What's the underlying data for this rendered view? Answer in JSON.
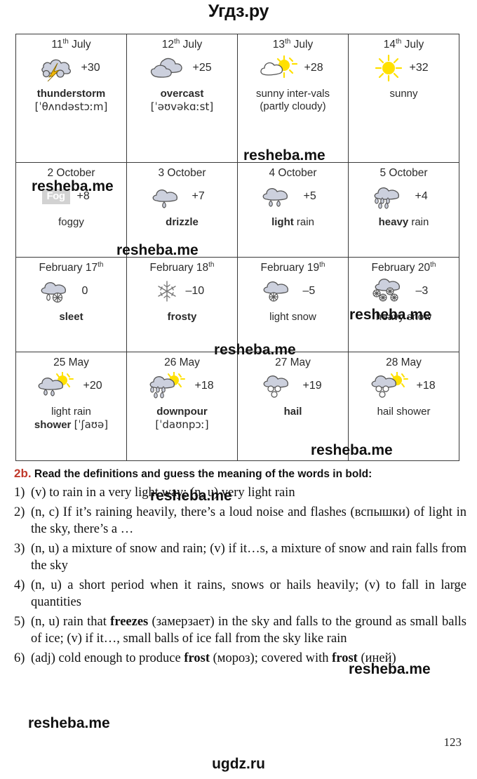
{
  "header": {
    "site_title": "Угдз.ру"
  },
  "footer": {
    "site_title": "ugdz.ru",
    "page_number": "123"
  },
  "weather_table": {
    "rows": [
      [
        {
          "date_num": "11",
          "date_sup": "th",
          "date_rest": " July",
          "date_prefix": "",
          "icon": "thunderstorm-icon",
          "temp": "+30",
          "label_bold": "thunderstorm",
          "label_plain": "",
          "ipa": "[ˈθʌndəstɔːm]"
        },
        {
          "date_num": "12",
          "date_sup": "th",
          "date_rest": " July",
          "date_prefix": "",
          "icon": "overcast-cloud-icon",
          "temp": "+25",
          "label_bold": "overcast",
          "label_plain": "",
          "ipa": "[ˈəʊvəkɑːst]"
        },
        {
          "date_num": "13",
          "date_sup": "th",
          "date_rest": " July",
          "date_prefix": "",
          "icon": "sun-behind-cloud-icon",
          "temp": "+28",
          "label_bold": "",
          "label_plain": "sunny inter-vals (partly cloudy)",
          "ipa": ""
        },
        {
          "date_num": "14",
          "date_sup": "th",
          "date_rest": " July",
          "date_prefix": "",
          "icon": "sun-icon",
          "temp": "+32",
          "label_bold": "",
          "label_plain": "sunny",
          "ipa": ""
        }
      ],
      [
        {
          "date_num": "2",
          "date_sup": "",
          "date_rest": " October",
          "date_prefix": "",
          "icon": "fog-badge-icon",
          "temp": "+8",
          "label_bold": "",
          "label_plain": "foggy",
          "ipa": ""
        },
        {
          "date_num": "3",
          "date_sup": "",
          "date_rest": " October",
          "date_prefix": "",
          "icon": "drizzle-icon",
          "temp": "+7",
          "label_bold": "drizzle",
          "label_plain": "",
          "ipa": ""
        },
        {
          "date_num": "4",
          "date_sup": "",
          "date_rest": " October",
          "date_prefix": "",
          "icon": "light-rain-icon",
          "temp": "+5",
          "label_bold": "light",
          "label_plain": " rain",
          "ipa": ""
        },
        {
          "date_num": "5",
          "date_sup": "",
          "date_rest": " October",
          "date_prefix": "",
          "icon": "heavy-rain-icon",
          "temp": "+4",
          "label_bold": "heavy",
          "label_plain": " rain",
          "ipa": ""
        }
      ],
      [
        {
          "date_num": "17",
          "date_sup": "th",
          "date_rest": "",
          "date_prefix": "February ",
          "icon": "sleet-icon",
          "temp": "0",
          "label_bold": "sleet",
          "label_plain": "",
          "ipa": ""
        },
        {
          "date_num": "18",
          "date_sup": "th",
          "date_rest": "",
          "date_prefix": "February ",
          "icon": "snowflake-icon",
          "temp": "–10",
          "label_bold": "frosty",
          "label_plain": "",
          "ipa": ""
        },
        {
          "date_num": "19",
          "date_sup": "th",
          "date_rest": "",
          "date_prefix": "February ",
          "icon": "light-snow-icon",
          "temp": "–5",
          "label_bold": "",
          "label_plain": "light snow",
          "ipa": ""
        },
        {
          "date_num": "20",
          "date_sup": "th",
          "date_rest": "",
          "date_prefix": "February ",
          "icon": "heavy-snow-icon",
          "temp": "–3",
          "label_bold": "",
          "label_plain": "heavy snow",
          "ipa": ""
        }
      ],
      [
        {
          "date_num": "25",
          "date_sup": "",
          "date_rest": " May",
          "date_prefix": "",
          "icon": "sunny-light-rain-icon",
          "temp": "+20",
          "label_bold": "shower",
          "label_plain": "light rain ",
          "ipa": "[ˈʃaʊə]"
        },
        {
          "date_num": "26",
          "date_sup": "",
          "date_rest": " May",
          "date_prefix": "",
          "icon": "downpour-icon",
          "temp": "+18",
          "label_bold": "downpour",
          "label_plain": "",
          "ipa": "[ˈdaʊnpɔː]"
        },
        {
          "date_num": "27",
          "date_sup": "",
          "date_rest": " May",
          "date_prefix": "",
          "icon": "hail-icon",
          "temp": "+19",
          "label_bold": "hail",
          "label_plain": "",
          "ipa": ""
        },
        {
          "date_num": "28",
          "date_sup": "",
          "date_rest": " May",
          "date_prefix": "",
          "icon": "hail-shower-icon",
          "temp": "+18",
          "label_bold": "",
          "label_plain": "hail shower",
          "ipa": ""
        }
      ]
    ]
  },
  "exercise": {
    "number": "2b.",
    "instruction": "Read the definitions and guess the meaning of the words in bold:",
    "items": [
      {
        "marker": "1)",
        "text": "(v) to rain in a very light way; (n, u) very light rain"
      },
      {
        "marker": "2)",
        "text": "(n, c) If it’s raining heavily, there’s a loud noise and flashes (вспышки) of light in the sky, there’s a …"
      },
      {
        "marker": "3)",
        "text": "(n, u) a mixture of snow and rain; (v) if it…s, a mixture of snow and rain falls from the sky"
      },
      {
        "marker": "4)",
        "text": "(n, u) a short period when it rains, snows or hails heavily; (v) to fall in large quantities"
      },
      {
        "marker": "5)",
        "text": "(n, u) rain that freezes (замерзает) in the sky and falls to the ground as small balls of ice; (v) if it…, small balls of ice fall from the sky like rain",
        "bold_words": [
          "freezes"
        ]
      },
      {
        "marker": "6)",
        "text": "(adj) cold enough to produce frost (мороз); covered with frost (иней)",
        "bold_words": [
          "frost",
          "frost"
        ]
      }
    ]
  },
  "watermarks": {
    "text": "resheba.me",
    "count": 9
  },
  "colors": {
    "accent_red": "#c0392b",
    "cloud_fill": "#ccd0dd",
    "cloud_stroke": "#555555",
    "sun_fill": "#ffe000",
    "lightning_fill": "#f2b705",
    "border": "#3a3a3a"
  }
}
